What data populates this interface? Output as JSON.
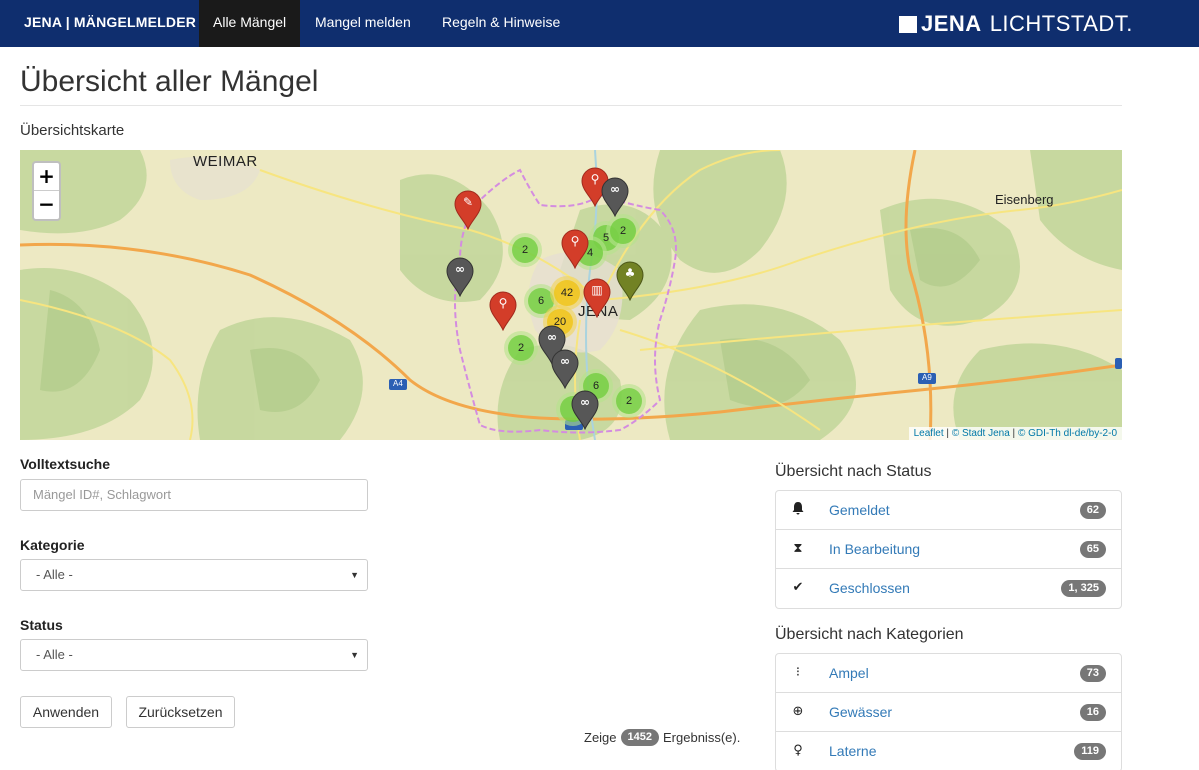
{
  "navbar": {
    "brand": "JENA | MÄNGELMELDER",
    "items": [
      {
        "label": "Alle Mängel",
        "active": true
      },
      {
        "label": "Mangel melden",
        "active": false
      },
      {
        "label": "Regeln & Hinweise",
        "active": false
      }
    ],
    "logo_bold": "JENA",
    "logo_light": "LICHTSTADT."
  },
  "page": {
    "title": "Übersicht aller Mängel",
    "map_heading": "Übersichtskarte"
  },
  "map": {
    "zoom_in": "+",
    "zoom_out": "−",
    "places": [
      "WEIMAR",
      "JENA",
      "Eisenberg"
    ],
    "road_shields": [
      "A4",
      "A9"
    ],
    "clusters": [
      "2",
      "5",
      "2",
      "4",
      "6",
      "42",
      "20",
      "2",
      "6",
      "2"
    ],
    "attribution": {
      "leaflet": "Leaflet",
      "stadt": "© Stadt Jena",
      "gdi": "© GDI-Th dl-de/by-2-0"
    }
  },
  "form": {
    "search_label": "Volltextsuche",
    "search_placeholder": "Mängel ID#, Schlagwort",
    "category_label": "Kategorie",
    "category_value": "- Alle -",
    "status_label": "Status",
    "status_value": "- Alle -",
    "apply_button": "Anwenden",
    "reset_button": "Zurücksetzen"
  },
  "results": {
    "prefix": "Zeige",
    "count": "1452",
    "suffix": "Ergebniss(e)."
  },
  "status_overview": {
    "heading": "Übersicht nach Status",
    "items": [
      {
        "icon": "bell-icon",
        "label": "Gemeldet",
        "count": "62"
      },
      {
        "icon": "hourglass-icon",
        "label": "In Bearbeitung",
        "count": "65"
      },
      {
        "icon": "checkmark-icon",
        "label": "Geschlossen",
        "count": "1, 325"
      }
    ]
  },
  "category_overview": {
    "heading": "Übersicht nach Kategorien",
    "items": [
      {
        "icon": "traffic-light-icon",
        "label": "Ampel",
        "count": "73"
      },
      {
        "icon": "life-ring-icon",
        "label": "Gewässer",
        "count": "16"
      },
      {
        "icon": "lightbulb-icon",
        "label": "Laterne",
        "count": "119"
      }
    ]
  },
  "colors": {
    "navbar": "#0f2e6e",
    "nav_active": "#1a1a1a",
    "link": "#337ab7",
    "badge": "#777777",
    "marker_red": "#d33d29",
    "marker_gray": "#575757",
    "marker_olive": "#728224"
  }
}
